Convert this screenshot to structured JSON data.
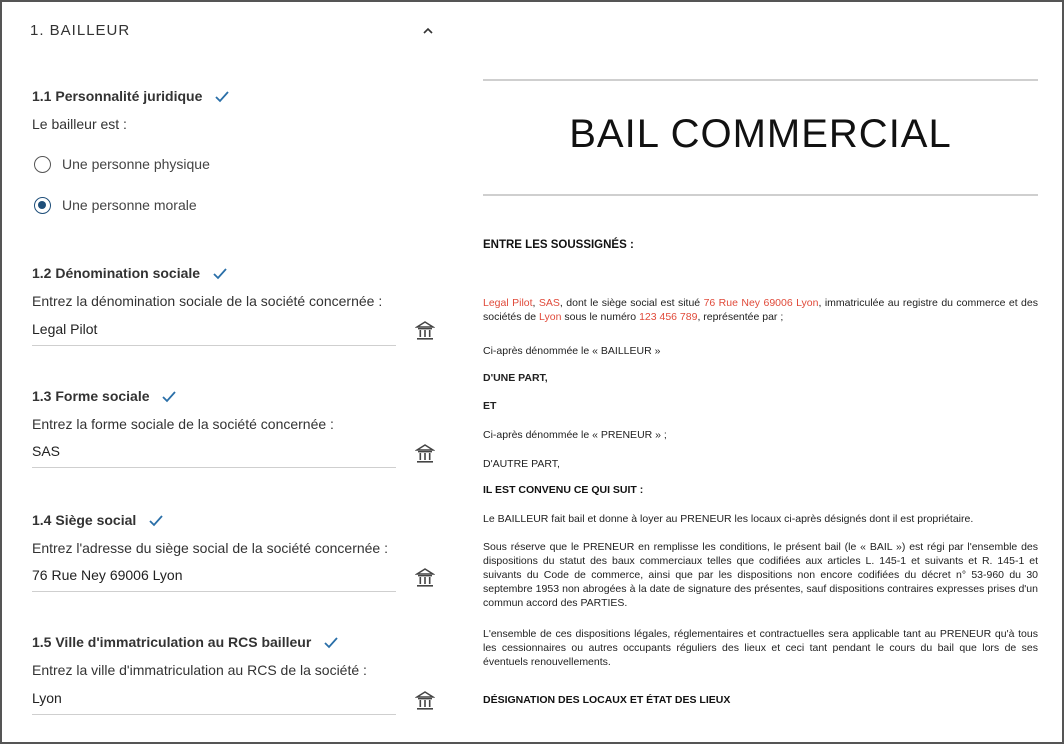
{
  "section": {
    "title": "1. BAILLEUR"
  },
  "q1": {
    "title": "1.1 Personnalité juridique",
    "help": "Le bailleur est :",
    "options": [
      "Une personne physique",
      "Une personne morale"
    ],
    "selected_index": 1
  },
  "q2": {
    "title": "1.2 Dénomination sociale",
    "help": "Entrez la dénomination sociale de la société concernée :",
    "value": "Legal Pilot"
  },
  "q3": {
    "title": "1.3 Forme sociale",
    "help": "Entrez la forme sociale de la société concernée :",
    "value": "SAS"
  },
  "q4": {
    "title": "1.4 Siège social",
    "help": "Entrez l'adresse du siège social de la société concernée :",
    "value": "76 Rue Ney 69006 Lyon"
  },
  "q5": {
    "title": "1.5 Ville d'immatriculation au RCS bailleur",
    "help": "Entrez la ville d'immatriculation au RCS de la société :",
    "value": "Lyon"
  },
  "icons": {
    "check": "checkmark-icon",
    "field_action": "bank-icon",
    "collapse": "chevron-up-icon"
  },
  "colors": {
    "accent": "#1f4f7a",
    "highlight": "#e04a3a"
  },
  "document": {
    "title": "BAIL COMMERCIAL",
    "parties_heading": "ENTRE LES SOUSSIGNÉS :",
    "p1": {
      "name": "Legal Pilot",
      "sep1": ", ",
      "form": "SAS",
      "t1": ", dont le siège social est situé ",
      "address": "76 Rue Ney 69006 Lyon",
      "t2": ", immatriculée au registre du commerce et des sociétés de ",
      "city": "Lyon",
      "t3": " sous le numéro ",
      "number": "123 456 789",
      "t4": ", représentée par ;"
    },
    "p2": "Ci-après dénommée le « BAILLEUR »",
    "p3": "D'UNE PART,",
    "p4": "ET",
    "p5": "Ci-après dénommée le « PRENEUR » ;",
    "p6": "D'AUTRE PART,",
    "h2": "IL EST CONVENU CE QUI SUIT :",
    "p7": "Le BAILLEUR fait bail et donne à loyer au PRENEUR les locaux ci-après désignés dont il est propriétaire.",
    "p8": "Sous réserve que le PRENEUR en remplisse les conditions, le présent bail (le « BAIL ») est régi par l'ensemble des dispositions du statut des baux commerciaux telles que codifiées aux articles L. 145-1 et suivants et R. 145-1 et suivants du Code de commerce, ainsi que par les dispositions non encore codifiées du décret n° 53-960 du 30 septembre 1953 non abrogées à la date de signature des présentes, sauf dispositions contraires expresses prises d'un commun accord des PARTIES.",
    "p9": "L'ensemble de ces dispositions légales, réglementaires et contractuelles sera applicable tant au PRENEUR qu'à tous les cessionnaires ou autres occupants réguliers des lieux et ceci tant pendant le cours du bail que lors de ses éventuels renouvellements.",
    "h3": "DÉSIGNATION DES LOCAUX ET ÉTAT DES LIEUX"
  }
}
